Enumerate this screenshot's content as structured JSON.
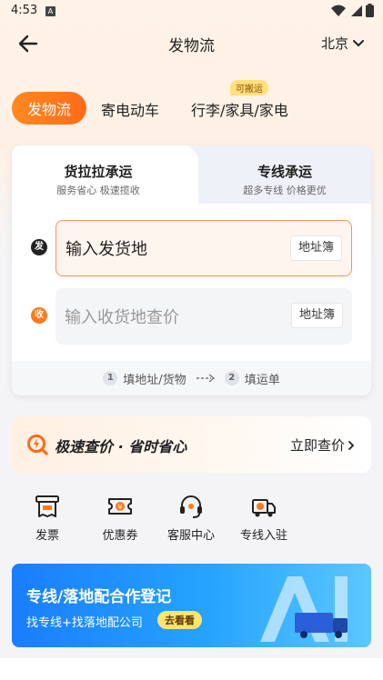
{
  "status_bar": {
    "time": "4:53",
    "notif_letter": "A"
  },
  "header": {
    "title": "发物流",
    "city": "北京"
  },
  "categories": {
    "items": [
      {
        "label": "发物流",
        "active": true
      },
      {
        "label": "寄电动车",
        "active": false
      },
      {
        "label": "行李/家具/家电",
        "active": false,
        "badge": "可搬运"
      }
    ]
  },
  "service_tabs": [
    {
      "title": "货拉拉承运",
      "subtitle": "服务省心 极速揽收",
      "active": true
    },
    {
      "title": "专线承运",
      "subtitle": "超多专线 价格更优",
      "active": false
    }
  ],
  "address": {
    "sender": {
      "badge": "发",
      "placeholder": "输入发货地",
      "book_label": "地址簿"
    },
    "receiver": {
      "badge": "收",
      "placeholder": "输入收货地查价",
      "book_label": "地址簿"
    }
  },
  "steps": [
    {
      "num": "1",
      "label": "填地址/货物"
    },
    {
      "num": "2",
      "label": "填运单"
    }
  ],
  "promo": {
    "title": "极速查价 · 省时省心",
    "link": "立即查价"
  },
  "services": [
    {
      "label": "发票",
      "icon": "invoice-icon"
    },
    {
      "label": "优惠券",
      "icon": "coupon-icon"
    },
    {
      "label": "客服中心",
      "icon": "headset-icon"
    },
    {
      "label": "专线入驻",
      "icon": "truck-join-icon"
    }
  ],
  "banner": {
    "title": "专线/落地配合作登记",
    "subtitle": "找专线+找落地配公司",
    "button": "去看看"
  },
  "colors": {
    "accent": "#ff7a1a",
    "blue": "#1a7dff"
  }
}
